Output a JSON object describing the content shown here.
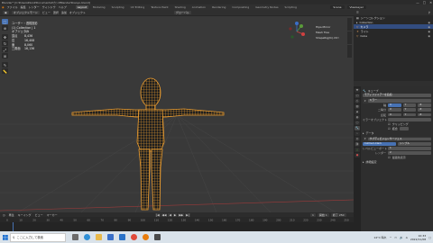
{
  "window": {
    "title": "Blender* [C:¥Users¥kon¥Documents¥カン¥Blender¥kaoyu.blend]",
    "controls": [
      "—",
      "□",
      "✕"
    ]
  },
  "menubar": {
    "items": [
      "ファイル",
      "編集",
      "レンダー",
      "ウィンドウ",
      "ヘルプ"
    ],
    "workspaces": [
      "Layout",
      "Modeling",
      "Sculpting",
      "UV Editing",
      "Texture Paint",
      "Shading",
      "Animation",
      "Rendering",
      "Compositing",
      "Geometry Nodes",
      "Scripting"
    ],
    "active_workspace": "Layout",
    "scene": "Scene",
    "view_layer": "ViewLayer"
  },
  "viewport_header": {
    "mode": "オブジェクトモード",
    "items": [
      "ビュー",
      "選択",
      "追加",
      "オブジェクト"
    ],
    "transform": "グローバル"
  },
  "viewport": {
    "view_name": "ユーザー・透視投影",
    "collection": "(1) Collection | 1",
    "stats_title": "オブジェクト",
    "stats_value": "1/1",
    "stats": [
      {
        "label": "頂点",
        "value": "8,436"
      },
      {
        "label": "辺",
        "value": "16,408"
      },
      {
        "label": "面",
        "value": "8,060"
      },
      {
        "label": "三角面",
        "value": "16,136"
      }
    ],
    "overlay_list": [
      "Hips.Mirror",
      "Mesh Tree",
      "ShapeRig(Ik).Ctrl"
    ],
    "accent": "#f0a030"
  },
  "timeline": {
    "items": [
      "再生",
      "キーイング",
      "ビュー",
      "マーカー"
    ],
    "controls": [
      "|◀",
      "◀◀",
      "◀",
      "▶",
      "▶▶",
      "▶|"
    ],
    "frame": "1",
    "start_label": "開始",
    "start": "1",
    "end_label": "終了",
    "end": "250",
    "ruler_numbers": [
      "0",
      "10",
      "20",
      "30",
      "40",
      "50",
      "60",
      "70",
      "80",
      "90",
      "100",
      "110",
      "120",
      "130",
      "140",
      "150",
      "160",
      "170",
      "180",
      "190",
      "200",
      "210",
      "220",
      "230",
      "240",
      "250"
    ]
  },
  "outliner": {
    "title": "シーンコレクション",
    "rows": [
      {
        "label": "シーンコレクション",
        "selected": false
      },
      {
        "label": "Collection",
        "selected": false
      },
      {
        "label": "カメラ",
        "selected": true
      },
      {
        "label": "ライト",
        "selected": false
      },
      {
        "label": "Cube",
        "selected": false
      }
    ]
  },
  "properties": {
    "object_name": "キューブ",
    "sections": [
      {
        "title": "モディファイアーを追加"
      },
      {
        "title": "ミラー"
      },
      {
        "title": "軸",
        "values": [
          "X",
          "Y",
          "Z"
        ]
      },
      {
        "title": "二等分",
        "values": [
          "X",
          "Y",
          "Z"
        ]
      },
      {
        "title": "反転",
        "values": [
          "X",
          "Y",
          "Z"
        ]
      },
      {
        "title": "ミラーオブジェクト"
      },
      {
        "title": "クリッピング"
      },
      {
        "title": "結合"
      },
      {
        "title": "データ"
      },
      {
        "title": "サブディビジョンサーフェス"
      },
      {
        "title": "Catmull-Clark"
      },
      {
        "title": "シンプル"
      },
      {
        "title": "レベルビューポート",
        "value": "1"
      },
      {
        "title": "レンダー",
        "value": "2"
      },
      {
        "title": "最適化表示"
      },
      {
        "title": "詳細設定"
      }
    ]
  },
  "taskbar": {
    "search_placeholder": "ここに入力して検索",
    "temperature": "14°C 晴れ",
    "ime": "A",
    "time": "10:33",
    "date": "2022/11/08"
  }
}
